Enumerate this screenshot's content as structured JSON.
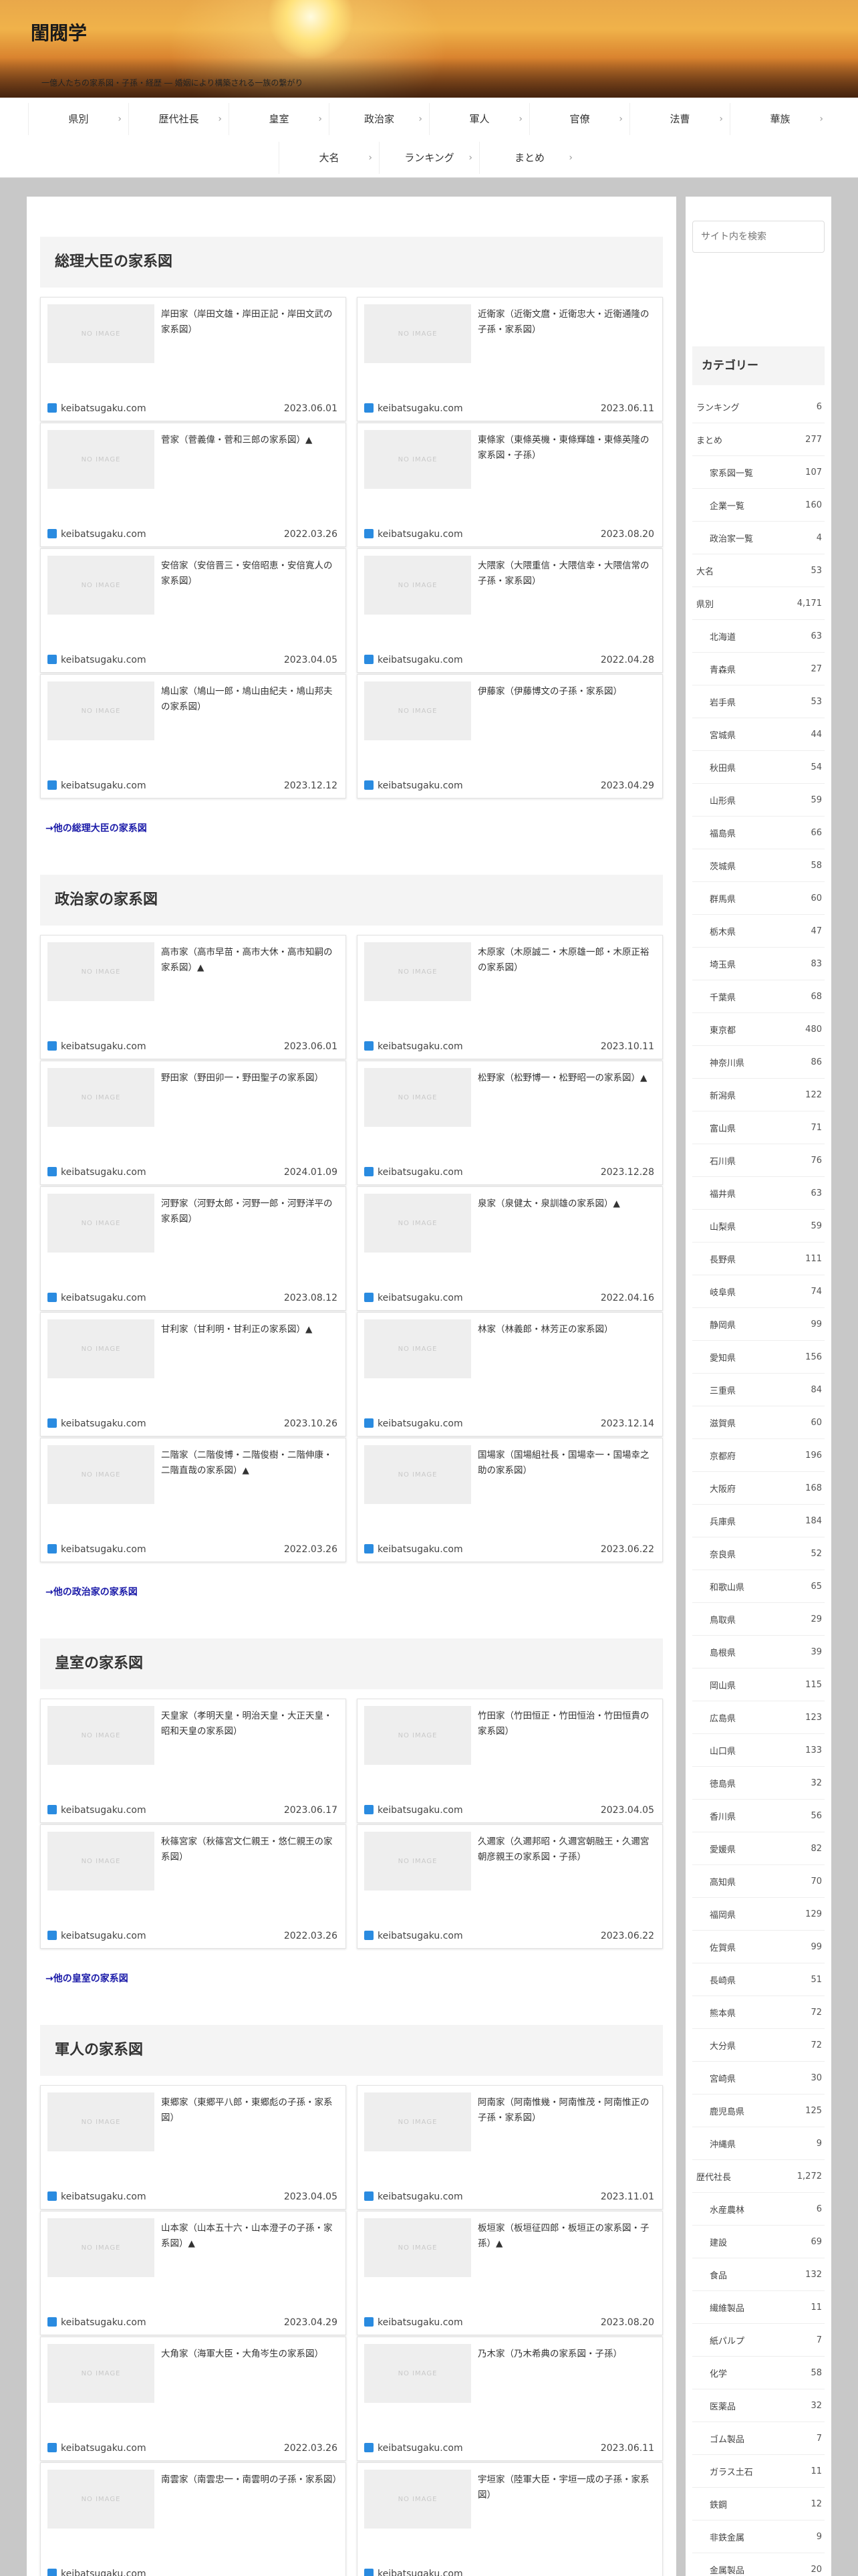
{
  "site": {
    "title": "閨閥学",
    "tagline": "一億人たちの家系図・子孫・経歴 ― 婚姻により構築される一族の繋がり"
  },
  "nav": {
    "row1": [
      "県別",
      "歴代社長",
      "皇室",
      "政治家",
      "軍人",
      "官僚",
      "法曹",
      "華族"
    ],
    "row2": [
      "大名",
      "ランキング",
      "まとめ"
    ]
  },
  "placeholder": "NO IMAGE",
  "source": "keibatsugaku.com",
  "sections": [
    {
      "title": "総理大臣の家系図",
      "more": "→他の総理大臣の家系図",
      "cards": [
        {
          "title": "岸田家（岸田文雄・岸田正記・岸田文武の家系図）",
          "date": "2023.06.01"
        },
        {
          "title": "近衛家（近衛文麿・近衛忠大・近衛通隆の子孫・家系図）",
          "date": "2023.06.11"
        },
        {
          "title": "菅家（菅義偉・菅和三郎の家系図）▲",
          "date": "2022.03.26"
        },
        {
          "title": "東條家（東條英機・東條輝雄・東條英隆の家系図・子孫）",
          "date": "2023.08.20"
        },
        {
          "title": "安倍家（安倍晋三・安倍昭恵・安倍寛人の家系図）",
          "date": "2023.04.05"
        },
        {
          "title": "大隈家（大隈重信・大隈信幸・大隈信常の子孫・家系図）",
          "date": "2022.04.28"
        },
        {
          "title": "鳩山家（鳩山一郎・鳩山由紀夫・鳩山邦夫の家系図）",
          "date": "2023.12.12"
        },
        {
          "title": "伊藤家（伊藤博文の子孫・家系図）",
          "date": "2023.04.29"
        }
      ]
    },
    {
      "title": "政治家の家系図",
      "more": "→他の政治家の家系図",
      "cards": [
        {
          "title": "高市家（高市早苗・高市大休・高市知嗣の家系図）▲",
          "date": "2023.06.01"
        },
        {
          "title": "木原家（木原誠二・木原雄一郎・木原正裕の家系図）",
          "date": "2023.10.11"
        },
        {
          "title": "野田家（野田卯一・野田聖子の家系図）",
          "date": "2024.01.09"
        },
        {
          "title": "松野家（松野博一・松野昭一の家系図）▲",
          "date": "2023.12.28"
        },
        {
          "title": "河野家（河野太郎・河野一郎・河野洋平の家系図）",
          "date": "2023.08.12"
        },
        {
          "title": "泉家（泉健太・泉訓雄の家系図）▲",
          "date": "2022.04.16"
        },
        {
          "title": "甘利家（甘利明・甘利正の家系図）▲",
          "date": "2023.10.26"
        },
        {
          "title": "林家（林義郎・林芳正の家系図）",
          "date": "2023.12.14"
        },
        {
          "title": "二階家（二階俊博・二階俊樹・二階伸康・二階直哉の家系図）▲",
          "date": "2022.03.26"
        },
        {
          "title": "国場家（国場組社長・国場幸一・国場幸之助の家系図）",
          "date": "2023.06.22"
        }
      ]
    },
    {
      "title": "皇室の家系図",
      "more": "→他の皇室の家系図",
      "cards": [
        {
          "title": "天皇家（孝明天皇・明治天皇・大正天皇・昭和天皇の家系図）",
          "date": "2023.06.17"
        },
        {
          "title": "竹田家（竹田恒正・竹田恒治・竹田恒貴の家系図）",
          "date": "2023.04.05"
        },
        {
          "title": "秋篠宮家（秋篠宮文仁親王・悠仁親王の家系図）",
          "date": "2022.03.26"
        },
        {
          "title": "久邇家（久邇邦昭・久邇宮朝融王・久邇宮朝彦親王の家系図・子孫）",
          "date": "2023.06.22"
        }
      ]
    },
    {
      "title": "軍人の家系図",
      "more": "",
      "cards": [
        {
          "title": "東郷家（東郷平八郎・東郷彪の子孫・家系図）",
          "date": "2023.04.05"
        },
        {
          "title": "阿南家（阿南惟幾・阿南惟茂・阿南惟正の子孫・家系図）",
          "date": "2023.11.01"
        },
        {
          "title": "山本家（山本五十六・山本澄子の子孫・家系図）▲",
          "date": "2023.04.29"
        },
        {
          "title": "板垣家（板垣征四郎・板垣正の家系図・子孫）▲",
          "date": "2023.08.20"
        },
        {
          "title": "大角家（海軍大臣・大角岑生の家系図）",
          "date": "2022.03.26"
        },
        {
          "title": "乃木家（乃木希典の家系図・子孫）",
          "date": "2023.06.11"
        },
        {
          "title": "南雲家（南雲忠一・南雲明の子孫・家系図）",
          "date": ""
        },
        {
          "title": "宇垣家（陸軍大臣・宇垣一成の子孫・家系図）",
          "date": ""
        }
      ]
    }
  ],
  "sidebar": {
    "search_placeholder": "サイト内を検索",
    "category_title": "カテゴリー",
    "categories": [
      {
        "name": "ランキング",
        "count": "6",
        "child": false
      },
      {
        "name": "まとめ",
        "count": "277",
        "child": false
      },
      {
        "name": "家系図一覧",
        "count": "107",
        "child": true
      },
      {
        "name": "企業一覧",
        "count": "160",
        "child": true
      },
      {
        "name": "政治家一覧",
        "count": "4",
        "child": true
      },
      {
        "name": "大名",
        "count": "53",
        "child": false
      },
      {
        "name": "県別",
        "count": "4,171",
        "child": false
      },
      {
        "name": "北海道",
        "count": "63",
        "child": true
      },
      {
        "name": "青森県",
        "count": "27",
        "child": true
      },
      {
        "name": "岩手県",
        "count": "53",
        "child": true
      },
      {
        "name": "宮城県",
        "count": "44",
        "child": true
      },
      {
        "name": "秋田県",
        "count": "54",
        "child": true
      },
      {
        "name": "山形県",
        "count": "59",
        "child": true
      },
      {
        "name": "福島県",
        "count": "66",
        "child": true
      },
      {
        "name": "茨城県",
        "count": "58",
        "child": true
      },
      {
        "name": "群馬県",
        "count": "60",
        "child": true
      },
      {
        "name": "栃木県",
        "count": "47",
        "child": true
      },
      {
        "name": "埼玉県",
        "count": "83",
        "child": true
      },
      {
        "name": "千葉県",
        "count": "68",
        "child": true
      },
      {
        "name": "東京都",
        "count": "480",
        "child": true
      },
      {
        "name": "神奈川県",
        "count": "86",
        "child": true
      },
      {
        "name": "新潟県",
        "count": "122",
        "child": true
      },
      {
        "name": "富山県",
        "count": "71",
        "child": true
      },
      {
        "name": "石川県",
        "count": "76",
        "child": true
      },
      {
        "name": "福井県",
        "count": "63",
        "child": true
      },
      {
        "name": "山梨県",
        "count": "59",
        "child": true
      },
      {
        "name": "長野県",
        "count": "111",
        "child": true
      },
      {
        "name": "岐阜県",
        "count": "74",
        "child": true
      },
      {
        "name": "静岡県",
        "count": "99",
        "child": true
      },
      {
        "name": "愛知県",
        "count": "156",
        "child": true
      },
      {
        "name": "三重県",
        "count": "84",
        "child": true
      },
      {
        "name": "滋賀県",
        "count": "60",
        "child": true
      },
      {
        "name": "京都府",
        "count": "196",
        "child": true
      },
      {
        "name": "大阪府",
        "count": "168",
        "child": true
      },
      {
        "name": "兵庫県",
        "count": "184",
        "child": true
      },
      {
        "name": "奈良県",
        "count": "52",
        "child": true
      },
      {
        "name": "和歌山県",
        "count": "65",
        "child": true
      },
      {
        "name": "鳥取県",
        "count": "29",
        "child": true
      },
      {
        "name": "島根県",
        "count": "39",
        "child": true
      },
      {
        "name": "岡山県",
        "count": "115",
        "child": true
      },
      {
        "name": "広島県",
        "count": "123",
        "child": true
      },
      {
        "name": "山口県",
        "count": "133",
        "child": true
      },
      {
        "name": "徳島県",
        "count": "32",
        "child": true
      },
      {
        "name": "香川県",
        "count": "56",
        "child": true
      },
      {
        "name": "愛媛県",
        "count": "82",
        "child": true
      },
      {
        "name": "高知県",
        "count": "70",
        "child": true
      },
      {
        "name": "福岡県",
        "count": "129",
        "child": true
      },
      {
        "name": "佐賀県",
        "count": "99",
        "child": true
      },
      {
        "name": "長崎県",
        "count": "51",
        "child": true
      },
      {
        "name": "熊本県",
        "count": "72",
        "child": true
      },
      {
        "name": "大分県",
        "count": "72",
        "child": true
      },
      {
        "name": "宮崎県",
        "count": "30",
        "child": true
      },
      {
        "name": "鹿児島県",
        "count": "125",
        "child": true
      },
      {
        "name": "沖縄県",
        "count": "9",
        "child": true
      },
      {
        "name": "歴代社長",
        "count": "1,272",
        "child": false
      },
      {
        "name": "水産農林",
        "count": "6",
        "child": true
      },
      {
        "name": "建設",
        "count": "69",
        "child": true
      },
      {
        "name": "食品",
        "count": "132",
        "child": true
      },
      {
        "name": "繊維製品",
        "count": "11",
        "child": true
      },
      {
        "name": "紙パルプ",
        "count": "7",
        "child": true
      },
      {
        "name": "化学",
        "count": "58",
        "child": true
      },
      {
        "name": "医薬品",
        "count": "32",
        "child": true
      },
      {
        "name": "ゴム製品",
        "count": "7",
        "child": true
      },
      {
        "name": "ガラス土石",
        "count": "11",
        "child": true
      },
      {
        "name": "鉄鋼",
        "count": "12",
        "child": true
      },
      {
        "name": "非鉄金属",
        "count": "9",
        "child": true
      },
      {
        "name": "金属製品",
        "count": "20",
        "child": true
      }
    ]
  }
}
